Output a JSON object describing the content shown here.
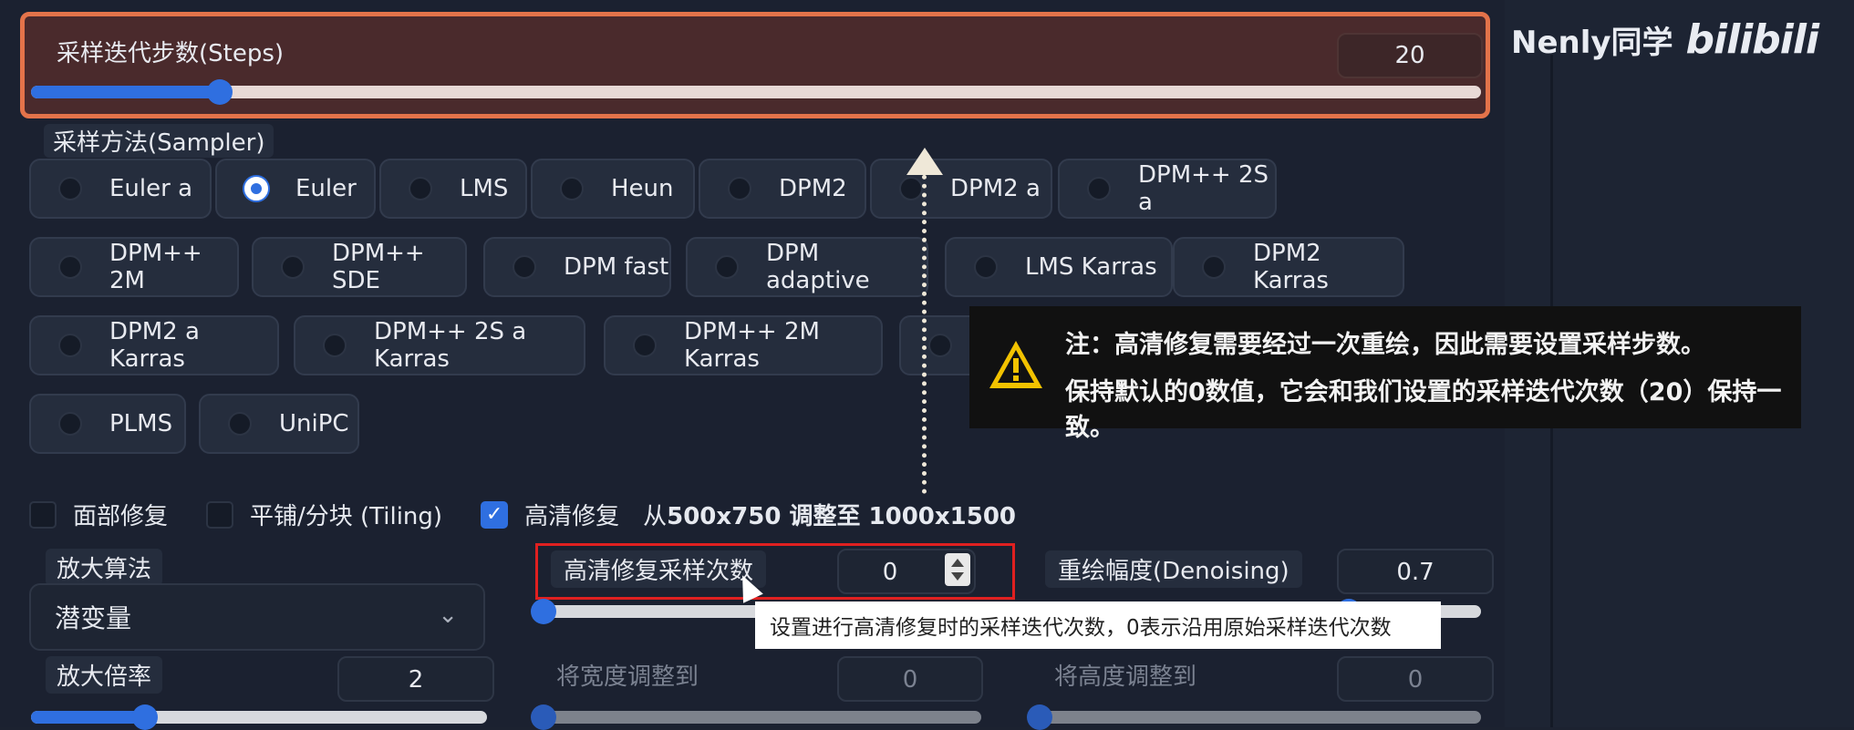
{
  "brand": {
    "author": "Nenly同学",
    "logo": "bilibili"
  },
  "steps": {
    "label": "采样迭代步数(Steps)",
    "value": "20",
    "fraction": 0.13
  },
  "sampler": {
    "title": "采样方法(Sampler)",
    "selected": "Euler",
    "options": [
      "Euler a",
      "Euler",
      "LMS",
      "Heun",
      "DPM2",
      "DPM2 a",
      "DPM++ 2S a",
      "DPM++ 2M",
      "DPM++ SDE",
      "DPM fast",
      "DPM adaptive",
      "LMS Karras",
      "DPM2 Karras",
      "DPM2 a Karras",
      "DPM++ 2S a Karras",
      "DPM++ 2M Karras",
      "PLMS",
      "UniPC"
    ]
  },
  "checks": {
    "face_restore": "面部修复",
    "tiling": "平铺/分块 (Tiling)",
    "hires": "高清修复",
    "hires_checked": true,
    "resize_prefix": "从 ",
    "resize_text": "500x750 调整至 1000x1500"
  },
  "upscaler": {
    "label": "放大算法",
    "value": "潜变量"
  },
  "hires_steps": {
    "label": "高清修复采样次数",
    "value": "0",
    "fraction": 0.0
  },
  "denoising": {
    "label": "重绘幅度(Denoising)",
    "value": "0.7",
    "fraction": 0.7
  },
  "scale": {
    "label": "放大倍率",
    "value": "2",
    "fraction": 0.25
  },
  "resize_width": {
    "label": "将宽度调整到",
    "value": "0"
  },
  "resize_height": {
    "label": "将高度调整到",
    "value": "0"
  },
  "tooltip": "设置进行高清修复时的采样迭代次数，0表示沿用原始采样迭代次数",
  "note": {
    "line1": "注：高清修复需要经过一次重绘，因此需要设置采样步数。",
    "line2": "保持默认的0数值，它会和我们设置的采样迭代次数（20）保持一致。"
  },
  "colors": {
    "accent": "#2f6fe0",
    "highlight_orange": "#e3734a",
    "highlight_red": "#e02020"
  }
}
